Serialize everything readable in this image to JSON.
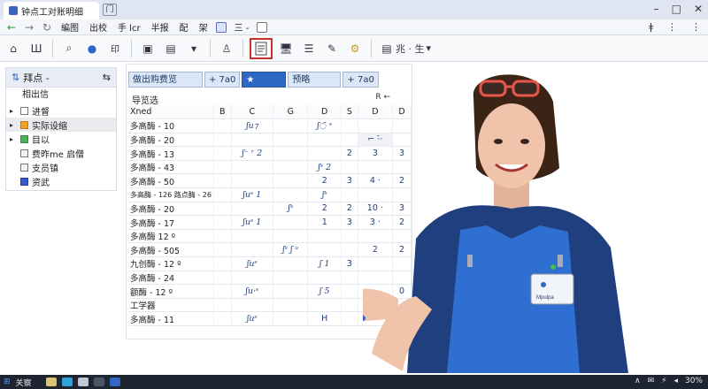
{
  "window": {
    "tab_title": "钟点工对账明细",
    "new_tab_label": "门",
    "controls": [
      "–",
      "□",
      "✕"
    ]
  },
  "menubar": {
    "items": [
      "編图",
      "出校",
      "手 lcr",
      "半报",
      "配",
      "架"
    ],
    "menu2": "三 -",
    "right_icons": [
      "ǂ",
      "⋮",
      "⋮"
    ]
  },
  "toolbar": {
    "buttons": [
      "⌂",
      "Ш",
      "⌕",
      "👤",
      "印",
      "▣",
      "▤",
      "▾",
      "♙",
      "📋",
      "🖥",
      "☰",
      "✎",
      "⚙"
    ],
    "text_label": "兆 · 生",
    "dropdown_arrow": "▾"
  },
  "sidebar": {
    "header": "拜点 -",
    "header_pin": "⇆",
    "section": "相出信",
    "items": [
      {
        "label": "进督",
        "check": "white",
        "arrow": "▸"
      },
      {
        "label": "实际设缩",
        "check": "orange",
        "arrow": "▸",
        "highlight": true
      },
      {
        "label": "目以",
        "check": "green",
        "arrow": "▸"
      },
      {
        "label": "费昨me 启僧",
        "check": "grey",
        "arrow": ""
      },
      {
        "label": "支员镇",
        "check": "grey",
        "arrow": ""
      },
      {
        "label": "资武",
        "check": "blue",
        "arrow": ""
      }
    ]
  },
  "panel": {
    "tabs": [
      {
        "label": "做出购费览",
        "style": "light"
      },
      {
        "label": "+ 7a0",
        "style": "light"
      },
      {
        "label": "★",
        "style": "blue"
      },
      {
        "label": "预略",
        "style": "light"
      },
      {
        "label": "+ 7a0",
        "style": "light"
      }
    ],
    "title": "导览选",
    "tag": "R ←",
    "columns": [
      "Xned",
      "B",
      "C",
      "G",
      "D",
      "S",
      "D",
      "D"
    ],
    "rows": [
      {
        "name": "多高酶 - 10",
        "cells": [
          "",
          "ʃu⁊",
          "",
          "ʃ◌̄ ˢ",
          "",
          "",
          ""
        ]
      },
      {
        "name": "多高酶 - 20",
        "cells": [
          "",
          "",
          "",
          "",
          "",
          "⌐ ·̄·",
          ""
        ]
      },
      {
        "name": "多高酶 - 13",
        "cells": [
          "",
          "ʃ⁻ ʳ 2",
          "",
          "",
          "2",
          "3",
          "3"
        ]
      },
      {
        "name": "多高酶 - 43",
        "cells": [
          "",
          "",
          "",
          "ʃˢ 2",
          "",
          "",
          ""
        ]
      },
      {
        "name": "多高酶 - 50",
        "cells": [
          "",
          "",
          "",
          "2",
          "3",
          "4 ·",
          "2"
        ]
      },
      {
        "name": "多高酶 - 126 路点酶 - 26",
        "cells": [
          "",
          "ʃuˢ 1",
          "",
          "ʃˢ",
          "",
          "",
          ""
        ]
      },
      {
        "name": "多高酶 - 20",
        "cells": [
          "",
          "",
          "ʃˢ ",
          "2",
          "2",
          "10 ·",
          "3"
        ]
      },
      {
        "name": "多高酶 - 17",
        "cells": [
          "",
          "ʃuˢ 1",
          "",
          "1",
          "3",
          "3 ·",
          "2"
        ]
      },
      {
        "name": "多高酶 12 º",
        "cells": [
          "",
          "",
          "",
          "",
          "",
          "",
          ""
        ]
      },
      {
        "name": "多高酶 - 505",
        "cells": [
          "",
          "",
          "ʃˢ ʃ ᵘ",
          "",
          "",
          "2",
          "2"
        ]
      },
      {
        "name": "九创酶 - 12 º",
        "cells": [
          "",
          "ʃuˢ ",
          "",
          "ʃ 1",
          "3",
          "",
          ""
        ]
      },
      {
        "name": "多高酶 - 24",
        "cells": [
          "",
          "",
          "",
          "",
          "",
          "",
          ""
        ]
      },
      {
        "name": "额酶 - 12 º",
        "cells": [
          "",
          "ʃu·ˢ",
          "",
          "ʃ 5",
          "",
          "",
          "0"
        ]
      },
      {
        "name": "工学器",
        "cells": [
          "",
          "",
          "",
          "",
          "",
          "",
          ""
        ]
      },
      {
        "name": "多高酶 - 11",
        "cells": [
          "",
          "ʃuˢ",
          "",
          "H",
          "",
          "",
          ""
        ]
      }
    ]
  },
  "badge": {
    "text": "Mpulpa"
  },
  "taskbar": {
    "start_label": "关察",
    "tray": [
      "∧",
      "✉",
      "⚡",
      "◂",
      "30%"
    ]
  },
  "colors": {
    "accent": "#2f67c4",
    "apron": "#2f6fd1",
    "shirt": "#1f3f7e",
    "active_outline": "#c9302c"
  }
}
